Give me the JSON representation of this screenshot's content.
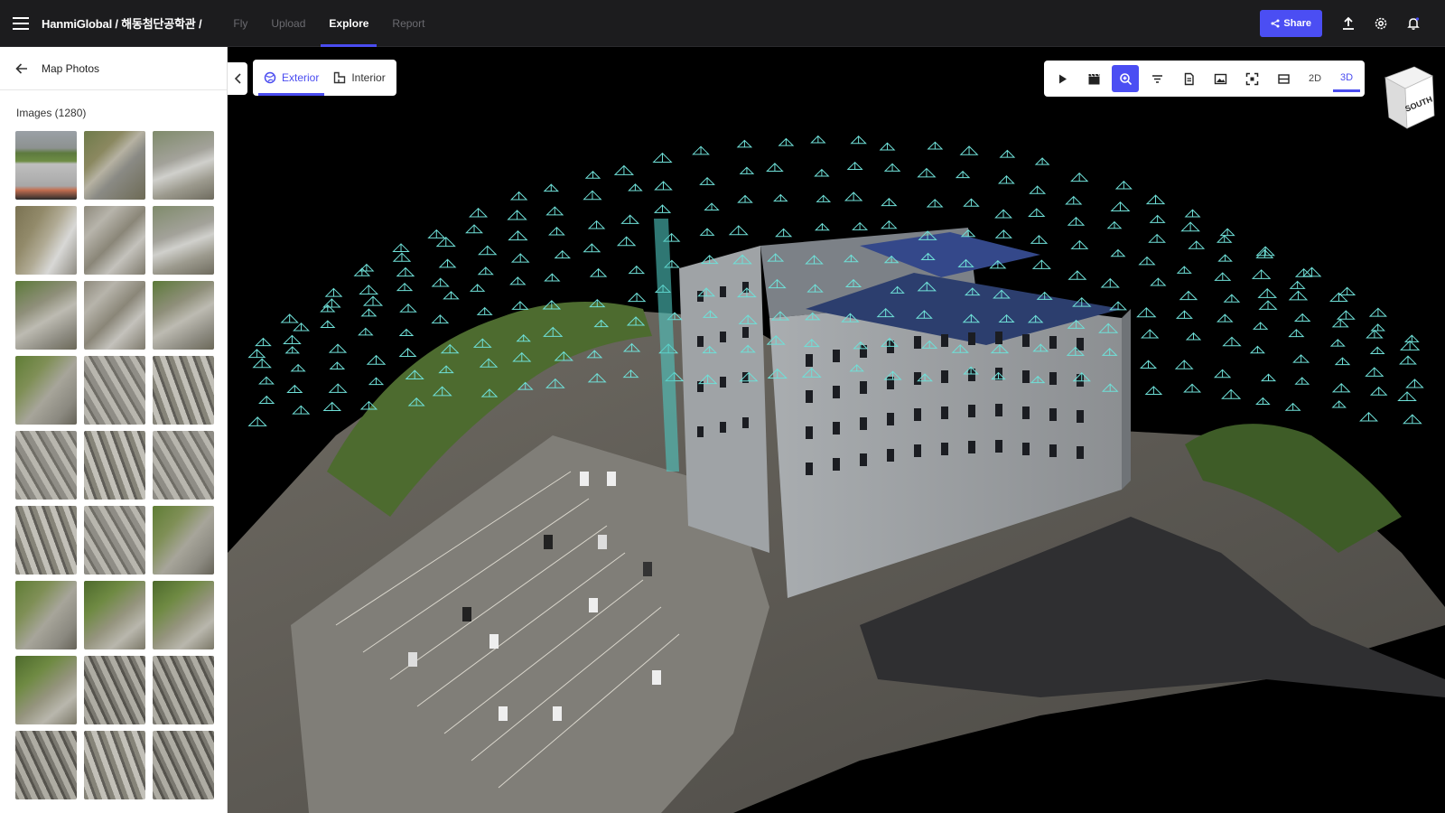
{
  "topbar": {
    "breadcrumb": "HanmiGlobal / 해동첨단공학관 /",
    "tabs": [
      {
        "label": "Fly",
        "active": false
      },
      {
        "label": "Upload",
        "active": false
      },
      {
        "label": "Explore",
        "active": true
      },
      {
        "label": "Report",
        "active": false
      }
    ],
    "share_label": "Share",
    "accent_color": "#4b4ef3"
  },
  "sidebar": {
    "title": "Map Photos",
    "images_label": "Images (1280)",
    "thumbnail_count": 27
  },
  "viewer": {
    "modes": [
      {
        "label": "Exterior",
        "icon": "globe-icon",
        "active": true
      },
      {
        "label": "Interior",
        "icon": "floorplan-icon",
        "active": false
      }
    ],
    "toolbar": {
      "view_2d": "2D",
      "view_3d": "3D",
      "tools": [
        "play-icon",
        "clapperboard-icon",
        "zoom-in-icon",
        "filter-icon",
        "document-icon",
        "image-icon",
        "fullscreen-icon",
        "layers-icon"
      ]
    },
    "view_cube_label": "SOUTH"
  }
}
